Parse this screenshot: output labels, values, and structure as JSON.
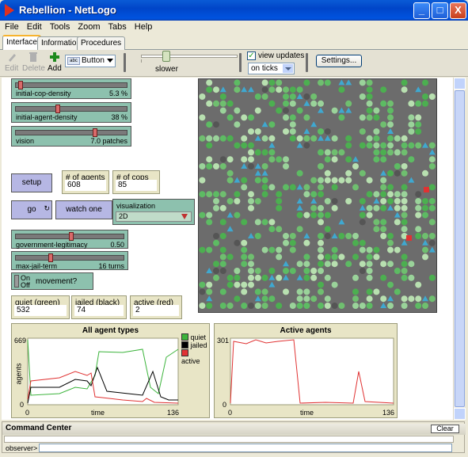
{
  "window": {
    "title": "Rebellion - NetLogo",
    "minimize": "_",
    "maximize": "□",
    "close": "X"
  },
  "menu": [
    "File",
    "Edit",
    "Tools",
    "Zoom",
    "Tabs",
    "Help"
  ],
  "tabs": [
    "Interface",
    "Information",
    "Procedures"
  ],
  "toolbar": {
    "edit": "Edit",
    "delete": "Delete",
    "add": "Add",
    "widget_type": "Button",
    "speed_label": "slower",
    "speed_value": 0.4,
    "view_updates": "view updates",
    "view_updates_checked": true,
    "update_mode": "on ticks",
    "settings": "Settings..."
  },
  "sliders": {
    "cop_density": {
      "label": "initial-cop-density",
      "value": "5.3 %",
      "fill": 0.06
    },
    "agent_density": {
      "label": "initial-agent-density",
      "value": "38 %",
      "fill": 0.38
    },
    "vision": {
      "label": "vision",
      "value": "7.0 patches",
      "fill": 0.7
    },
    "legitimacy": {
      "label": "government-legitimacy",
      "value": "0.50",
      "fill": 0.5
    },
    "jail_term": {
      "label": "max-jail-term",
      "value": "16 turns",
      "fill": 0.33
    }
  },
  "buttons": {
    "setup": "setup",
    "go": "go",
    "watch": "watch one"
  },
  "monitors": {
    "agents": {
      "label": "# of agents",
      "value": "608"
    },
    "cops": {
      "label": "# of cops",
      "value": "85"
    },
    "quiet": {
      "label": "quiet (green)",
      "value": "532"
    },
    "jailed": {
      "label": "jailed (black)",
      "value": "74"
    },
    "active": {
      "label": "active (red)",
      "value": "2"
    }
  },
  "chooser": {
    "label": "visualization",
    "value": "2D"
  },
  "switch": {
    "on": "On",
    "off": "Off",
    "label": "movement?"
  },
  "plot1": {
    "title": "All agent types",
    "ymax": "669",
    "ymin": "0",
    "xmin": "0",
    "xmax": "136",
    "xlabel": "time",
    "ylabel": "agents",
    "legend": [
      {
        "name": "quiet",
        "color": "#3CB43C"
      },
      {
        "name": "jailed",
        "color": "#000000"
      },
      {
        "name": "active",
        "color": "#E03232"
      }
    ]
  },
  "plot2": {
    "title": "Active agents",
    "ymax": "301",
    "ymin": "0",
    "xmin": "0",
    "xmax": "136",
    "xlabel": "time"
  },
  "command_center": {
    "title": "Command Center",
    "clear": "Clear",
    "prompt": "observer>"
  },
  "colors": {
    "quiet": "#3CB43C",
    "jailed": "#000000",
    "active": "#E03232",
    "cop": "#3FA8D0"
  }
}
